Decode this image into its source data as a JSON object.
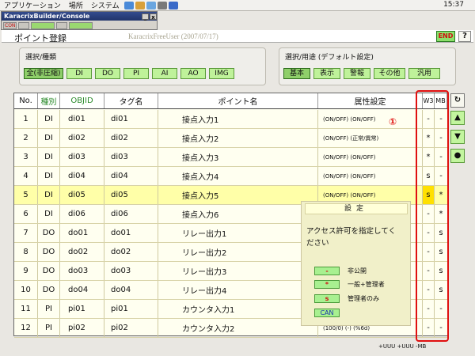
{
  "topbar": {
    "menu": [
      "アプリケーション",
      "場所",
      "システム"
    ],
    "clock": "15:37"
  },
  "console": {
    "title": "KaracrixBuilder/Console",
    "minimize": "_",
    "close": "x",
    "tools": [
      "CON",
      "",
      "",
      "",
      ""
    ]
  },
  "header": {
    "title": "ポイント登録",
    "user": "KaracrixFreeUser (2007/07/17)",
    "end_label": "END",
    "help_label": "?"
  },
  "type_panel": {
    "label": "選択/種類",
    "buttons": [
      "全(非圧縮)",
      "DI",
      "DO",
      "PI",
      "AI",
      "AO",
      "IMG"
    ]
  },
  "use_panel": {
    "label": "選択/用途 (デフォルト設定)",
    "buttons": [
      "基本",
      "表示",
      "警報",
      "その他",
      "汎用"
    ]
  },
  "table": {
    "columns": {
      "no": "No.",
      "kind": "種別",
      "objid": "OBJID",
      "tag": "タグ名",
      "point": "ポイント名",
      "attr": "属性設定",
      "w3": "W3",
      "mb": "MB"
    },
    "rows": [
      {
        "no": "1",
        "kind": "DI",
        "objid": "di01",
        "tag": "di01",
        "point": "接点入力1",
        "attr": "(ON/OFF) (ON/OFF)",
        "w3": "-",
        "mb": "-"
      },
      {
        "no": "2",
        "kind": "DI",
        "objid": "di02",
        "tag": "di02",
        "point": "接点入力2",
        "attr": "(ON/OFF) (正常/異常)",
        "w3": "*",
        "mb": "-"
      },
      {
        "no": "3",
        "kind": "DI",
        "objid": "di03",
        "tag": "di03",
        "point": "接点入力3",
        "attr": "(ON/OFF) (ON/OFF)",
        "w3": "*",
        "mb": "-"
      },
      {
        "no": "4",
        "kind": "DI",
        "objid": "di04",
        "tag": "di04",
        "point": "接点入力4",
        "attr": "(ON/OFF) (ON/OFF)",
        "w3": "s",
        "mb": "-"
      },
      {
        "no": "5",
        "kind": "DI",
        "objid": "di05",
        "tag": "di05",
        "point": "接点入力5",
        "attr": "(ON/OFF) (ON/OFF)",
        "w3": "s",
        "mb": "*"
      },
      {
        "no": "6",
        "kind": "DI",
        "objid": "di06",
        "tag": "di06",
        "point": "接点入力6",
        "attr": "",
        "w3": "-",
        "mb": "*"
      },
      {
        "no": "7",
        "kind": "DO",
        "objid": "do01",
        "tag": "do01",
        "point": "リレー出力1",
        "attr": "",
        "w3": "-",
        "mb": "s"
      },
      {
        "no": "8",
        "kind": "DO",
        "objid": "do02",
        "tag": "do02",
        "point": "リレー出力2",
        "attr": "",
        "w3": "-",
        "mb": "s"
      },
      {
        "no": "9",
        "kind": "DO",
        "objid": "do03",
        "tag": "do03",
        "point": "リレー出力3",
        "attr": "",
        "w3": "-",
        "mb": "s"
      },
      {
        "no": "10",
        "kind": "DO",
        "objid": "do04",
        "tag": "do04",
        "point": "リレー出力4",
        "attr": "",
        "w3": "-",
        "mb": "s"
      },
      {
        "no": "11",
        "kind": "PI",
        "objid": "pi01",
        "tag": "pi01",
        "point": "カウンタ入力1",
        "attr": "",
        "w3": "-",
        "mb": "-"
      },
      {
        "no": "12",
        "kind": "PI",
        "objid": "pi02",
        "tag": "pi02",
        "point": "カウンタ入力2",
        "attr": "(100/0) (-) (%6d)",
        "w3": "-",
        "mb": "-"
      }
    ]
  },
  "annotation": "①",
  "side_nav": {
    "refresh": "↻",
    "up": "▲",
    "down": "▼",
    "dot": "●"
  },
  "popup": {
    "title": "設定",
    "message": "アクセス許可を指定してください",
    "options": [
      {
        "sym": "-",
        "label": "非公開"
      },
      {
        "sym": "*",
        "label": "一般+管理者"
      },
      {
        "sym": "s",
        "label": "管理者のみ"
      },
      {
        "sym": "CAN",
        "label": ""
      }
    ]
  },
  "footer": "+UUU +UUU -MB",
  "colors": {
    "highlight_row": "#ffffa8",
    "w3_selected": "#ffe000",
    "red_frame": "#e01010",
    "green_button": "#bff29a"
  }
}
